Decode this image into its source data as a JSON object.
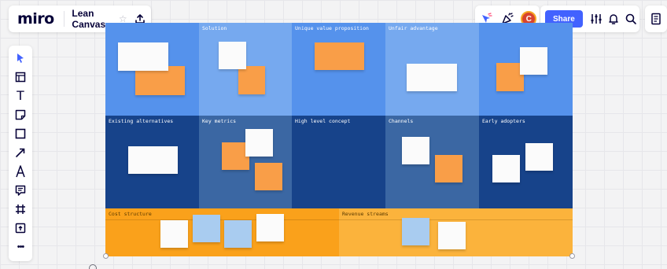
{
  "app": {
    "logo": "miro",
    "board_name": "Lean Canvas"
  },
  "header": {
    "share_label": "Share",
    "avatar_initial": "C",
    "icons": [
      "star-icon",
      "upload-icon",
      "reactions-icon",
      "celebrate-icon",
      "settings-sliders-icon",
      "bell-icon",
      "search-icon",
      "notes-icon"
    ]
  },
  "toolbar": {
    "tools": [
      "select-tool",
      "frame-tool",
      "text-tool",
      "sticky-note-tool",
      "shape-tool",
      "arrow-tool",
      "pen-tool",
      "comment-tool",
      "crop-frame-tool",
      "upload-tool",
      "more-tool"
    ],
    "text_tool_glyph": "T",
    "more_glyph": "•••"
  },
  "canvas": {
    "rows": [
      [
        "",
        "Solution",
        "Unique value proposition",
        "Unfair advantage",
        ""
      ],
      [
        "Existing alternatives",
        "Key metrics",
        "High level concept",
        "Channels",
        "Early adopters"
      ],
      [
        "Cost structure",
        "Revenue streams"
      ]
    ]
  },
  "colors": {
    "accent": "#4262ff",
    "cell_blue": "#5592ec",
    "cell_blue_light": "#76a9ef",
    "cell_navy": "#17438a",
    "cell_navy_light": "#3b67a3",
    "cell_orange": "#faa11b",
    "cell_orange_light": "#fbb33c",
    "sticky_orange": "#f99e48",
    "sticky_white": "#fbfbfb",
    "sticky_blue": "#a9ccf0"
  }
}
